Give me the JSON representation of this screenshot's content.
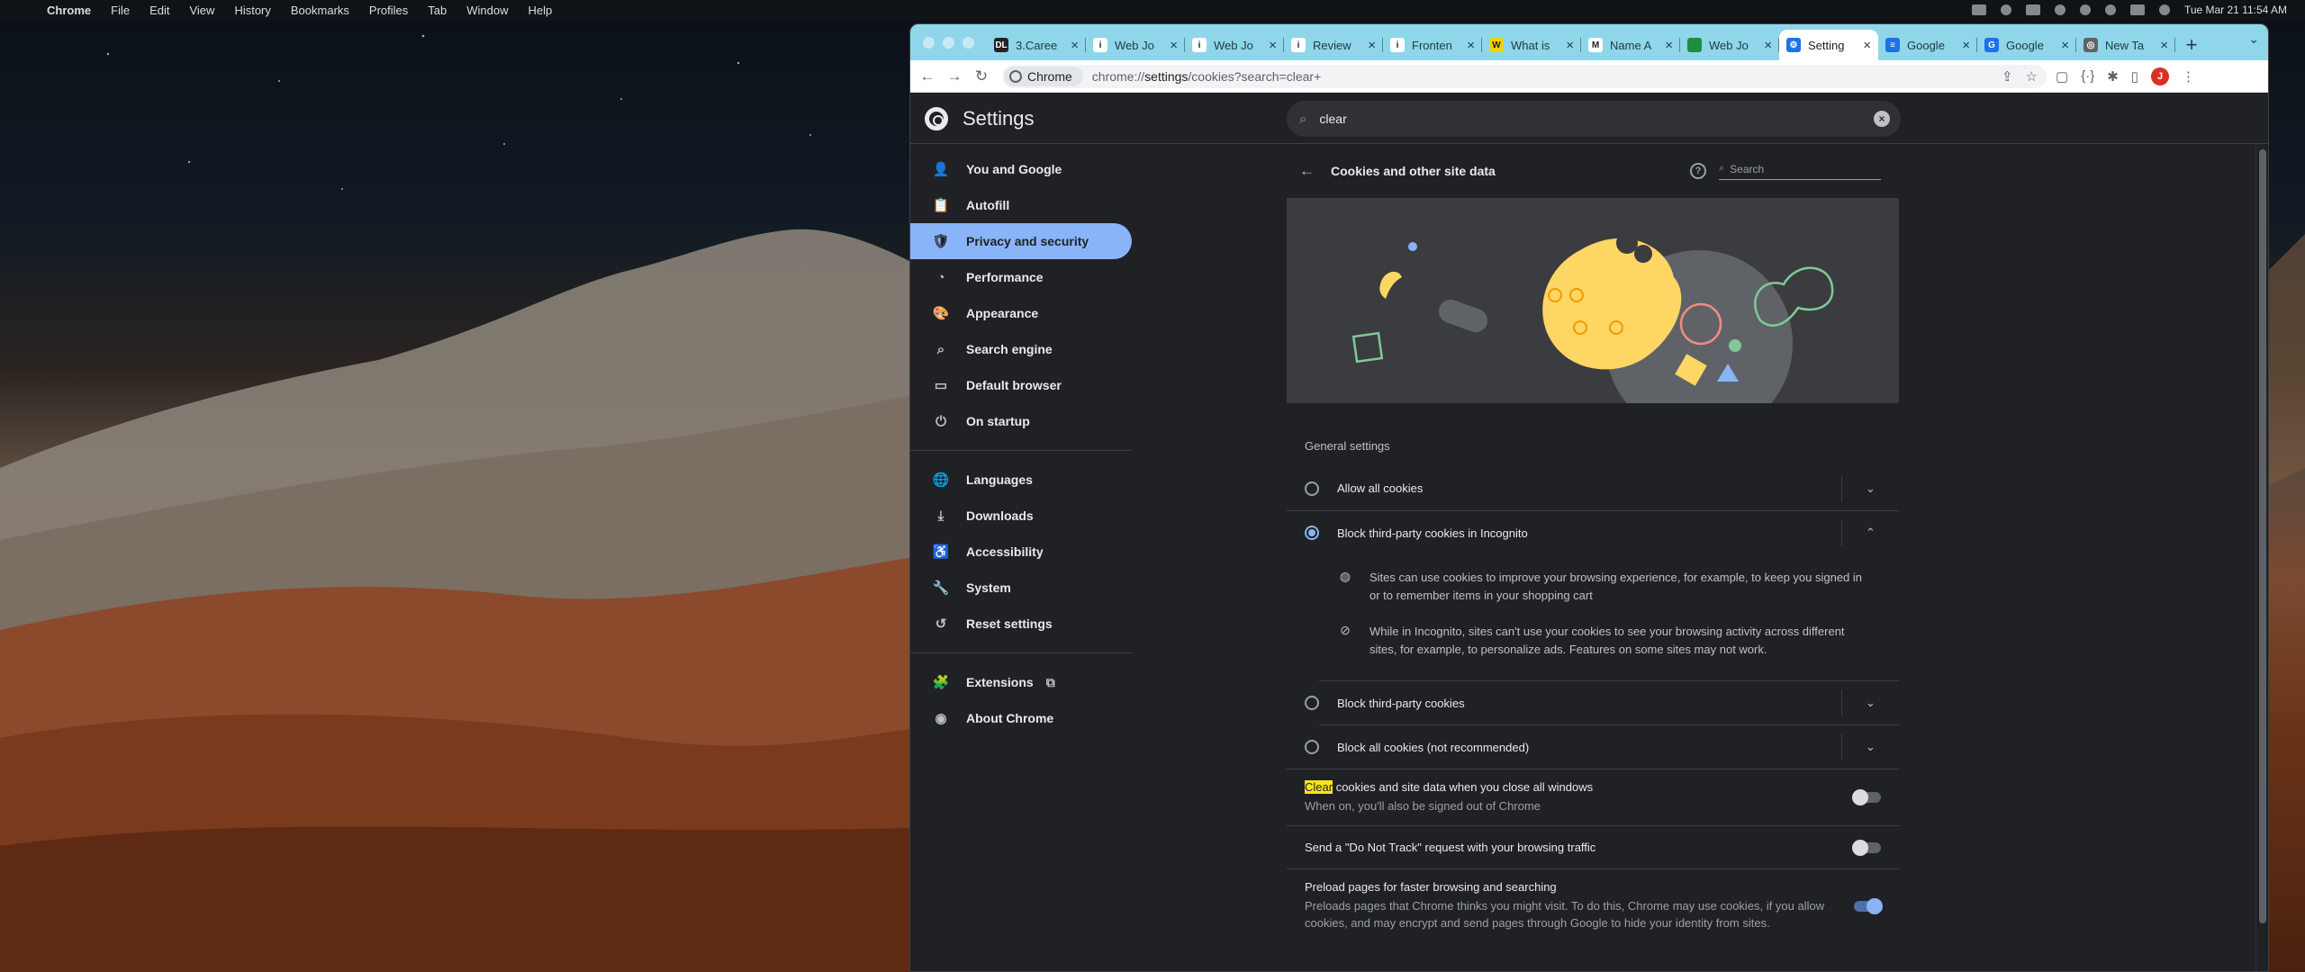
{
  "menubar": {
    "items": [
      "Chrome",
      "File",
      "Edit",
      "View",
      "History",
      "Bookmarks",
      "Profiles",
      "Tab",
      "Window",
      "Help"
    ],
    "clock": "Tue Mar 21  11:54 AM"
  },
  "tabs": [
    {
      "label": "3.Caree",
      "fav_color": "#222222",
      "fav_text": "DL"
    },
    {
      "label": "Web Jo",
      "fav_color": "#ffffff",
      "fav_text": "i"
    },
    {
      "label": "Web Jo",
      "fav_color": "#ffffff",
      "fav_text": "i"
    },
    {
      "label": "Review",
      "fav_color": "#ffffff",
      "fav_text": "i"
    },
    {
      "label": "Fronten",
      "fav_color": "#ffffff",
      "fav_text": "i"
    },
    {
      "label": "What is",
      "fav_color": "#f2d200",
      "fav_text": "W"
    },
    {
      "label": "Name A",
      "fav_color": "#ffffff",
      "fav_text": "M"
    },
    {
      "label": "Web Jo",
      "fav_color": "#1e8e3e",
      "fav_text": ""
    },
    {
      "label": "Setting",
      "fav_color": "#1a73e8",
      "fav_text": "⚙",
      "active": true
    },
    {
      "label": "Google",
      "fav_color": "#1a73e8",
      "fav_text": "≡"
    },
    {
      "label": "Google",
      "fav_color": "#1a73e8",
      "fav_text": "G"
    },
    {
      "label": "New Ta",
      "fav_color": "#5f6368",
      "fav_text": "◎"
    }
  ],
  "toolbar": {
    "site_chip": "Chrome",
    "url_prefix": "chrome://",
    "url_host": "settings",
    "url_rest": "/cookies?search=clear+",
    "avatar": "J"
  },
  "settings": {
    "title": "Settings",
    "search_value": "clear",
    "nav": [
      {
        "label": "You and Google",
        "icon": "person-icon",
        "glyph": "👤"
      },
      {
        "label": "Autofill",
        "icon": "clipboard-icon",
        "glyph": "📋"
      },
      {
        "label": "Privacy and security",
        "icon": "shield-icon",
        "glyph": "🛡",
        "active": true
      },
      {
        "label": "Performance",
        "icon": "speedometer-icon",
        "glyph": "◔"
      },
      {
        "label": "Appearance",
        "icon": "palette-icon",
        "glyph": "🎨"
      },
      {
        "label": "Search engine",
        "icon": "search-icon",
        "glyph": "⌕"
      },
      {
        "label": "Default browser",
        "icon": "browser-icon",
        "glyph": "▭"
      },
      {
        "label": "On startup",
        "icon": "power-icon",
        "glyph": "⏻"
      }
    ],
    "nav2": [
      {
        "label": "Languages",
        "icon": "globe-icon",
        "glyph": "🌐"
      },
      {
        "label": "Downloads",
        "icon": "download-icon",
        "glyph": "⤓"
      },
      {
        "label": "Accessibility",
        "icon": "accessibility-icon",
        "glyph": "♿"
      },
      {
        "label": "System",
        "icon": "wrench-icon",
        "glyph": "🔧"
      },
      {
        "label": "Reset settings",
        "icon": "reset-icon",
        "glyph": "↺"
      }
    ],
    "nav3": [
      {
        "label": "Extensions",
        "icon": "puzzle-icon",
        "glyph": "🧩",
        "external": true
      },
      {
        "label": "About Chrome",
        "icon": "chrome-icon",
        "glyph": "◉"
      }
    ],
    "page": {
      "title": "Cookies and other site data",
      "search_placeholder": "Search",
      "general_settings": "General settings",
      "options": [
        {
          "label": "Allow all cookies",
          "selected": false,
          "expanded": false
        },
        {
          "label": "Block third-party cookies in Incognito",
          "selected": true,
          "expanded": true
        },
        {
          "label": "Block third-party cookies",
          "selected": false,
          "expanded": false
        },
        {
          "label": "Block all cookies (not recommended)",
          "selected": false,
          "expanded": false
        }
      ],
      "expanded_details": [
        {
          "icon": "cookie-icon",
          "text": "Sites can use cookies to improve your browsing experience, for example, to keep you signed in or to remember items in your shopping cart"
        },
        {
          "icon": "block-icon",
          "text": "While in Incognito, sites can't use your cookies to see your browsing activity across different sites, for example, to personalize ads. Features on some sites may not work."
        }
      ],
      "toggles": [
        {
          "highlight": "Clear",
          "label": " cookies and site data when you close all windows",
          "sub": "When on, you'll also be signed out of Chrome",
          "on": false
        },
        {
          "highlight": "",
          "label": "Send a \"Do Not Track\" request with your browsing traffic",
          "sub": "",
          "on": false
        },
        {
          "highlight": "",
          "label": "Preload pages for faster browsing and searching",
          "sub": "Preloads pages that Chrome thinks you might visit. To do this, Chrome may use cookies, if you allow cookies, and may encrypt and send pages through Google to hide your identity from sites.",
          "on": true
        }
      ]
    }
  }
}
